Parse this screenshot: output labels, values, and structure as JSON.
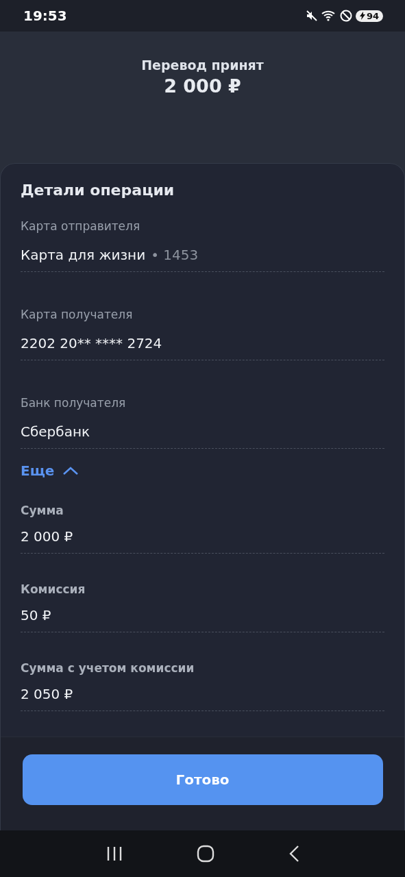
{
  "status_bar": {
    "time": "19:53",
    "battery": "94"
  },
  "header": {
    "title": "Перевод принят",
    "amount": "2 000 ₽"
  },
  "details": {
    "title": "Детали операции",
    "fields": [
      {
        "label": "Карта отправителя",
        "value": "Карта для жизни",
        "suffix": "• 1453"
      },
      {
        "label": "Карта получателя",
        "value": "2202 20** **** 2724"
      },
      {
        "label": "Банк получателя",
        "value": "Сбербанк"
      }
    ],
    "more": {
      "label": "Еще",
      "expanded": true,
      "fields": [
        {
          "label": "Сумма",
          "value": "2 000 ₽"
        },
        {
          "label": "Комиссия",
          "value": "50 ₽"
        },
        {
          "label": "Сумма с учетом комиссии",
          "value": "2 050 ₽"
        }
      ]
    }
  },
  "done_button": "Готово"
}
